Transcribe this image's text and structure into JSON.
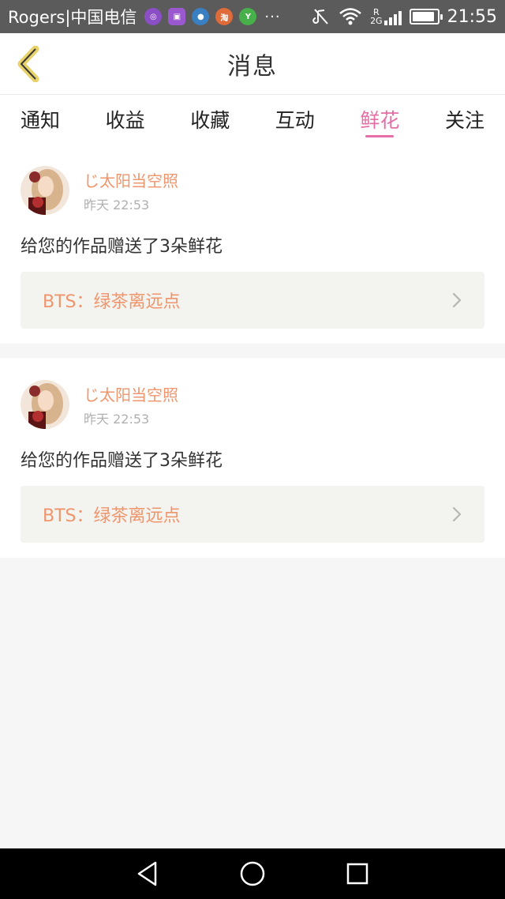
{
  "status_bar": {
    "carrier": "Rogers|中国电信",
    "overflow": "···",
    "network_type": "2G",
    "roaming": "R",
    "battery_level": 0.9,
    "time": "21:55"
  },
  "header": {
    "title": "消息",
    "back_icon": "chevron-left-icon"
  },
  "tabs": [
    {
      "label": "通知",
      "active": false
    },
    {
      "label": "收益",
      "active": false
    },
    {
      "label": "收藏",
      "active": false
    },
    {
      "label": "互动",
      "active": false
    },
    {
      "label": "鲜花",
      "active": true
    },
    {
      "label": "关注",
      "active": false
    }
  ],
  "messages": [
    {
      "user_name": "じ太阳当空照",
      "timestamp": "昨天 22:53",
      "text": "给您的作品赠送了3朵鲜花",
      "work_title": "BTS：绿茶离远点"
    },
    {
      "user_name": "じ太阳当空照",
      "timestamp": "昨天 22:53",
      "text": "给您的作品赠送了3朵鲜花",
      "work_title": "BTS：绿茶离远点"
    }
  ],
  "colors": {
    "accent_pink": "#e46ea5",
    "name_orange": "#f0956b",
    "back_icon_yellow": "#e8d26a"
  }
}
